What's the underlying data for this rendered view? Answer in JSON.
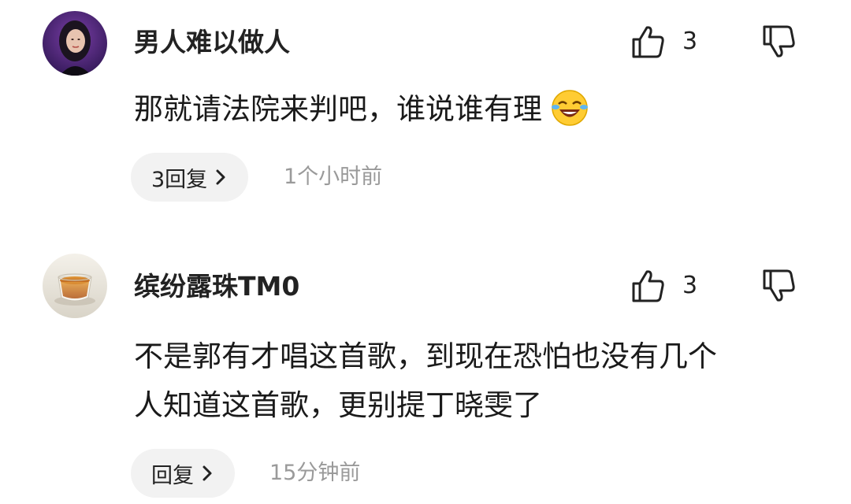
{
  "comments": [
    {
      "username": "男人难以做人",
      "avatar_icon": "avatar-woman-portrait",
      "like_count": "3",
      "content": "那就请法院来判吧，谁说谁有理",
      "emoji": "laughing-crying-emoji",
      "reply_label": "3回复",
      "timestamp": "1个小时前"
    },
    {
      "username": "缤纷露珠TM0",
      "avatar_icon": "avatar-tea-cup",
      "like_count": "3",
      "content_line1": "不是郭有才唱这首歌，到现在恐怕也没有几个",
      "content_line2": "人知道这首歌，更别提丁晓雯了",
      "reply_label": "回复",
      "timestamp": "15分钟前"
    }
  ],
  "colors": {
    "text_primary": "#222222",
    "text_secondary": "#9a9a9a",
    "pill_background": "#f2f2f2",
    "background": "#ffffff"
  },
  "icons": {
    "like": "thumbs-up-icon",
    "dislike": "thumbs-down-icon",
    "chevron": "chevron-right-icon"
  }
}
